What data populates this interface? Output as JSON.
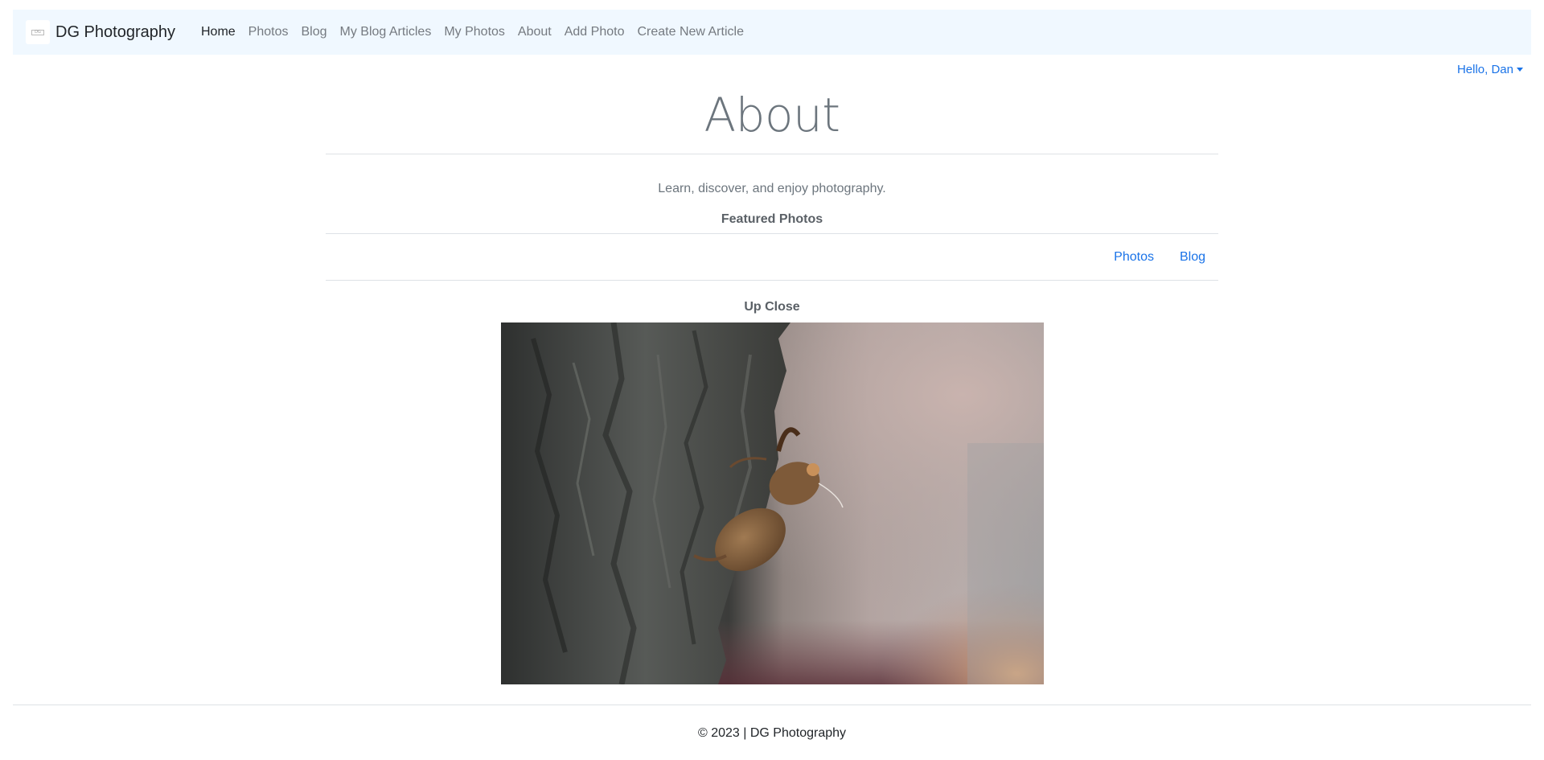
{
  "navbar": {
    "brand": "DG Photography",
    "links": [
      {
        "label": "Home",
        "active": true
      },
      {
        "label": "Photos",
        "active": false
      },
      {
        "label": "Blog",
        "active": false
      },
      {
        "label": "My Blog Articles",
        "active": false
      },
      {
        "label": "My Photos",
        "active": false
      },
      {
        "label": "About",
        "active": false
      },
      {
        "label": "Add Photo",
        "active": false
      },
      {
        "label": "Create New Article",
        "active": false
      }
    ]
  },
  "user_menu": {
    "label": "Hello, Dan",
    "icon": "caret-down-icon"
  },
  "page": {
    "title": "About",
    "tagline": "Learn, discover, and enjoy photography.",
    "section_heading": "Featured Photos"
  },
  "subnav": {
    "links": [
      "Photos",
      "Blog"
    ]
  },
  "featured_photo": {
    "title": "Up Close"
  },
  "footer": {
    "text": "© 2023 | DG Photography"
  },
  "colors": {
    "navbar_bg": "#f0f8ff",
    "link_blue": "#1a73e8",
    "muted_text": "#6c757d",
    "divider": "#dee2e6"
  }
}
